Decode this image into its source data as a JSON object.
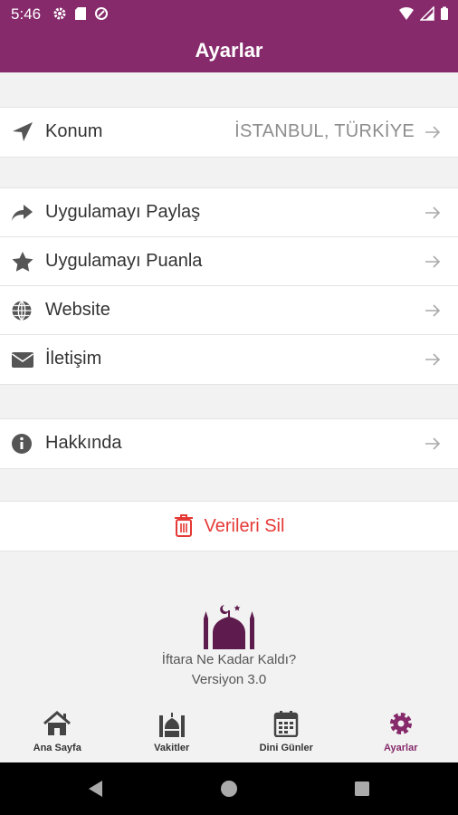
{
  "status_bar": {
    "time": "5:46"
  },
  "header": {
    "title": "Ayarlar"
  },
  "location": {
    "label": "Konum",
    "value": "İSTANBUL, TÜRKİYE"
  },
  "menu": [
    {
      "label": "Uygulamayı Paylaş",
      "icon": "share-icon"
    },
    {
      "label": "Uygulamayı Puanla",
      "icon": "star-icon"
    },
    {
      "label": "Website",
      "icon": "globe-icon"
    },
    {
      "label": "İletişim",
      "icon": "envelope-icon"
    }
  ],
  "about": {
    "label": "Hakkında",
    "icon": "info-icon"
  },
  "delete": {
    "label": "Verileri Sil",
    "color": "#e53935"
  },
  "footer": {
    "app_name": "İftara Ne Kadar Kaldı?",
    "version": "Versiyon 3.0"
  },
  "bottom_nav": [
    {
      "label": "Ana Sayfa",
      "icon": "home-icon"
    },
    {
      "label": "Vakitler",
      "icon": "mosque-icon"
    },
    {
      "label": "Dini Günler",
      "icon": "calendar-icon"
    },
    {
      "label": "Ayarlar",
      "icon": "gear-icon",
      "active": true
    }
  ],
  "theme": {
    "primary": "#862a6b",
    "danger": "#e53935"
  }
}
